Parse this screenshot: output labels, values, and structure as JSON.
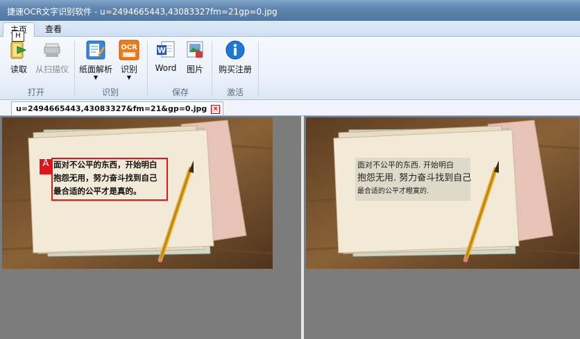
{
  "window": {
    "title": "捷速OCR文字识别软件 - u=2494665443,43083327fm=21gp=0.jpg"
  },
  "tabs": [
    {
      "label": "主页",
      "key": "H"
    },
    {
      "label": "查看"
    }
  ],
  "ribbon": {
    "groups": [
      {
        "label": "打开",
        "buttons": [
          {
            "label": "读取",
            "icon": "folder-open-icon"
          },
          {
            "label": "从扫描仪",
            "icon": "scanner-icon",
            "disabled": true
          }
        ]
      },
      {
        "label": "识别",
        "buttons": [
          {
            "label": "纸面解析",
            "icon": "page-analysis-icon"
          },
          {
            "label": "识别",
            "icon": "ocr-icon"
          }
        ]
      },
      {
        "label": "保存",
        "buttons": [
          {
            "label": "Word",
            "icon": "word-icon"
          },
          {
            "label": "图片",
            "icon": "image-icon"
          }
        ]
      },
      {
        "label": "激活",
        "buttons": [
          {
            "label": "购买注册",
            "icon": "info-icon"
          }
        ]
      }
    ]
  },
  "document_tab": {
    "label": "u=2494665443,43083327&fm=21&gp=0.jpg"
  },
  "source_pane": {
    "lines": [
      "面对不公平的东西，开始明白",
      "抱怨无用，努力奋斗找到自己",
      "最合适的公平才是真的。"
    ],
    "block_badge": "A"
  },
  "result_pane": {
    "lines": [
      "面对不公平的东西.  开始明白",
      "抱怨无用. 努力奋斗找到自己",
      "最合适的公平才瞪寞的."
    ]
  },
  "colors": {
    "title_bar": "#5f86b0",
    "selection": "#e0151b",
    "wood": "#7a5632",
    "paper": "#f2ead6"
  }
}
